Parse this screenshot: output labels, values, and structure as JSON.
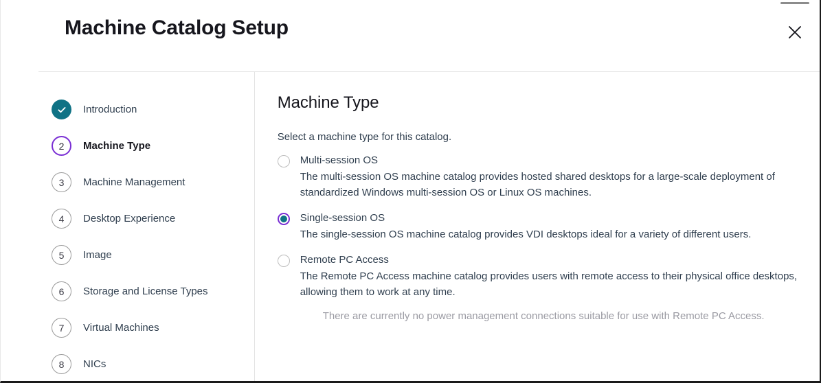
{
  "window": {
    "title": "Machine Catalog Setup",
    "close_icon": "close-icon"
  },
  "colors": {
    "done_teal": "#0f7285",
    "current_purple": "#7a2fd4",
    "text": "#2f3e4e",
    "muted": "#9a9aa2"
  },
  "sidebar": {
    "steps": [
      {
        "number": "",
        "label": "Introduction",
        "state": "done"
      },
      {
        "number": "2",
        "label": "Machine Type",
        "state": "current"
      },
      {
        "number": "3",
        "label": "Machine Management",
        "state": "todo"
      },
      {
        "number": "4",
        "label": "Desktop Experience",
        "state": "todo"
      },
      {
        "number": "5",
        "label": "Image",
        "state": "todo"
      },
      {
        "number": "6",
        "label": "Storage and License Types",
        "state": "todo"
      },
      {
        "number": "7",
        "label": "Virtual Machines",
        "state": "todo"
      },
      {
        "number": "8",
        "label": "NICs",
        "state": "todo"
      }
    ]
  },
  "main": {
    "title": "Machine Type",
    "subtitle": "Select a machine type for this catalog.",
    "options": [
      {
        "label": "Multi-session OS",
        "description": "The multi-session OS machine catalog provides hosted shared desktops for a large-scale deployment of standardized Windows multi-session OS or Linux OS machines.",
        "selected": false
      },
      {
        "label": "Single-session OS",
        "description": "The single-session OS machine catalog provides VDI desktops ideal for a variety of different users.",
        "selected": true
      },
      {
        "label": "Remote PC Access",
        "description": "The Remote PC Access machine catalog provides users with remote access to their physical office desktops, allowing them to work at any time.",
        "selected": false
      }
    ],
    "note": "There are currently no power management connections suitable for use with Remote PC Access."
  }
}
